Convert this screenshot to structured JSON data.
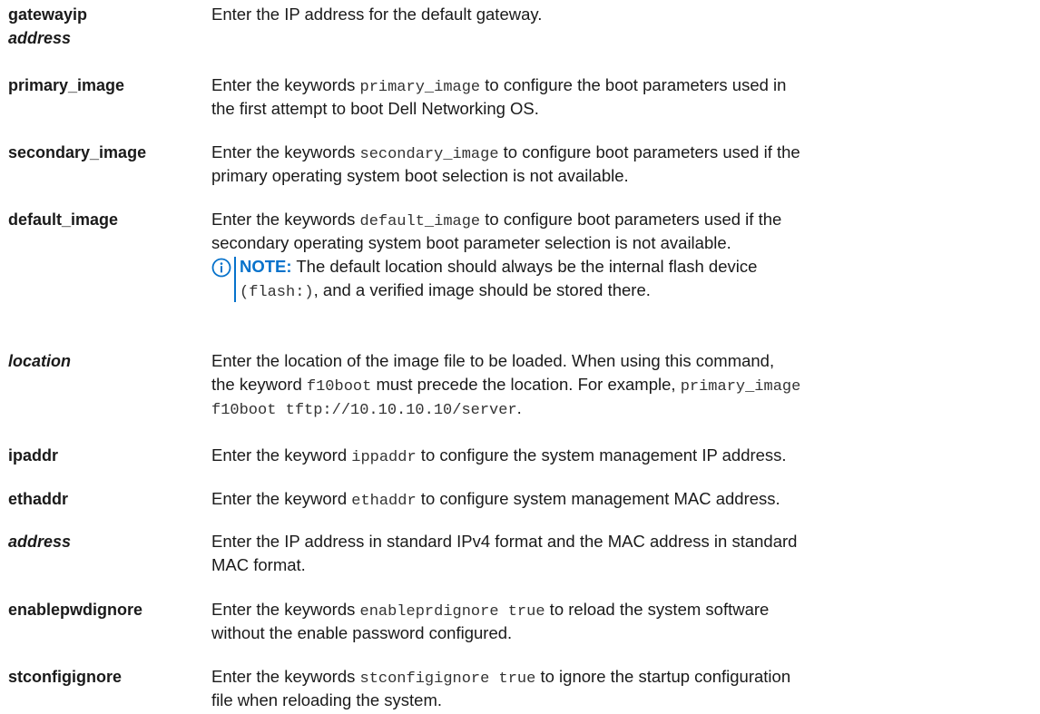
{
  "params": [
    {
      "term_lines": [
        "gatewayip",
        "address"
      ],
      "desc_lines": [
        [
          "Enter the IP address for the default gateway."
        ]
      ]
    },
    {
      "term": "primary_image",
      "desc_lines": [
        [
          "Enter the keywords ",
          "primary_image",
          " to configure the boot parameters used in"
        ],
        [
          "the first attempt to boot Dell Networking OS."
        ]
      ]
    },
    {
      "term": "secondary_image",
      "desc_lines": [
        [
          "Enter the keywords ",
          "secondary_image",
          " to configure boot parameters used if the"
        ],
        [
          "primary operating system boot selection is not available."
        ]
      ]
    },
    {
      "term": "default_image",
      "desc_lines": [
        [
          "Enter the keywords ",
          "default_image",
          " to configure boot parameters used if the"
        ],
        [
          "secondary operating system boot parameter selection is not available."
        ]
      ],
      "note": {
        "label": "NOTE:",
        "line1": " The default location should always be the internal flash device",
        "line2_mono": "(flash:)",
        "line2_rest": ", and a verified image should be stored there.",
        "icon": "info-icon"
      }
    },
    {
      "term": "location",
      "desc_lines": [
        [
          "Enter the location of the image file to be loaded. When using this command,"
        ],
        [
          "the keyword ",
          "f10boot",
          " must precede the location. For example, ",
          "primary_image"
        ],
        [
          "",
          "f10boot tftp://10.10.10.10/server",
          "."
        ]
      ]
    },
    {
      "term": "ipaddr",
      "desc_lines": [
        [
          "Enter the keyword ",
          "ippaddr",
          " to configure the system management IP address."
        ]
      ]
    },
    {
      "term": "ethaddr",
      "desc_lines": [
        [
          "Enter the keyword ",
          "ethaddr",
          " to configure system management MAC address."
        ]
      ]
    },
    {
      "term": "address",
      "desc_lines": [
        [
          "Enter the IP address in standard IPv4 format and the MAC address in standard"
        ],
        [
          "MAC format."
        ]
      ]
    },
    {
      "term": "enablepwdignore",
      "desc_lines": [
        [
          "Enter the keywords ",
          "enableprdignore true",
          " to reload the system software"
        ],
        [
          "without the enable password configured."
        ]
      ]
    },
    {
      "term": "stconfigignore",
      "desc_lines": [
        [
          "Enter the keywords ",
          "stconfigignore true",
          " to ignore the startup configuration"
        ],
        [
          "file when reloading the system."
        ]
      ]
    }
  ],
  "colors": {
    "text": "#1a1a1a",
    "note_accent": "#0672cb"
  }
}
